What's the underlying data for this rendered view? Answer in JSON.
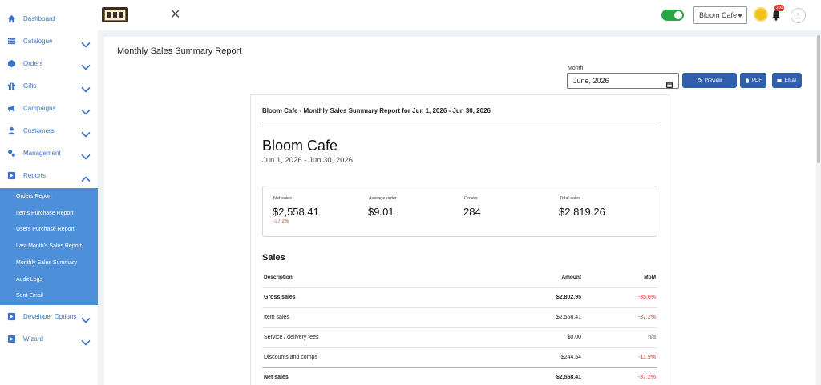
{
  "sidebar": {
    "items": [
      {
        "label": "Dashboard",
        "icon": "home-icon",
        "chevron": ""
      },
      {
        "label": "Catalogue",
        "icon": "list-icon",
        "chevron": "down"
      },
      {
        "label": "Orders",
        "icon": "box-icon",
        "chevron": "down"
      },
      {
        "label": "Gifts",
        "icon": "gift-icon",
        "chevron": "down"
      },
      {
        "label": "Campaigns",
        "icon": "megaphone-icon",
        "chevron": "down"
      },
      {
        "label": "Customers",
        "icon": "user-icon",
        "chevron": "down"
      },
      {
        "label": "Management",
        "icon": "gears-icon",
        "chevron": "down"
      },
      {
        "label": "Reports",
        "icon": "report-icon",
        "chevron": "up"
      }
    ],
    "reports_submenu": [
      "Orders Report",
      "Items Purchase Report",
      "Users Purchase Report",
      "Last Month's Sales Report",
      "Monthly Sales Summary",
      "Audit Logs",
      "Sent Email"
    ],
    "bottom_items": [
      {
        "label": "Developer Options",
        "icon": "report-icon",
        "chevron": "down"
      },
      {
        "label": "Wizard",
        "icon": "report-icon",
        "chevron": "down"
      }
    ]
  },
  "topbar": {
    "store_select": "Bloom Cafe",
    "notification_count": "200",
    "close_symbol": "✕"
  },
  "page": {
    "title": "Monthly Sales Summary Report",
    "month_label": "Month",
    "month_value": "June, 2026",
    "buttons": {
      "preview": "Preview",
      "pdf": "PDF",
      "email": "Email"
    }
  },
  "report": {
    "header": "Bloom Cafe - Monthly Sales Summary Report for Jun 1, 2026 - Jun 30, 2026",
    "store_name": "Bloom Cafe",
    "date_range": "Jun 1, 2026 - Jun 30, 2026",
    "kpis": [
      {
        "label": "Net sales",
        "value": "$2,558.41",
        "change": "-37.2%"
      },
      {
        "label": "Average order",
        "value": "$9.01",
        "change": ""
      },
      {
        "label": "Orders",
        "value": "284",
        "change": ""
      },
      {
        "label": "Total sales",
        "value": "$2,819.26",
        "change": ""
      }
    ],
    "sales_title": "Sales",
    "columns": {
      "description": "Description",
      "amount": "Amount",
      "mom": "MoM"
    },
    "rows": [
      {
        "description": "Gross sales",
        "amount": "$2,802.95",
        "mom": "-35.6%"
      },
      {
        "description": "Item sales",
        "amount": "$2,558.41",
        "mom": "-37.2%"
      },
      {
        "description": "Service / delivery fees",
        "amount": "$0.00",
        "mom": "n/a"
      },
      {
        "description": "Discounts and comps",
        "amount": "-$244.54",
        "mom": "-11.9%"
      },
      {
        "description": "Net sales",
        "amount": "$2,558.41",
        "mom": "-37.2%"
      }
    ]
  },
  "colors": {
    "sidebar_link": "#3c73c9",
    "submenu_bg": "#4d8fd8",
    "button_bg": "#2f5fad",
    "negative": "#e03131",
    "toggle_on": "#28a745"
  }
}
